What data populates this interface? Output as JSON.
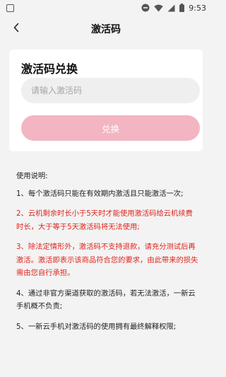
{
  "status_bar": {
    "time": "9:53"
  },
  "header": {
    "title": "激活码"
  },
  "redeem_card": {
    "title": "激活码兑换",
    "input_placeholder": "请输入激活码",
    "input_value": "",
    "button_label": "兑换"
  },
  "instructions": {
    "heading": "使用说明:",
    "items": [
      {
        "text": "1、每个激活码只能在有效期内激活且只能激活一次;",
        "color": "#222222"
      },
      {
        "text": "2、云机剩余时长小于5天时才能使用激活码给云机续费时长，大于等于5天激活码将无法使用;",
        "color": "#e0241d"
      },
      {
        "text": "3、除法定情形外，激活码不支持退款，请充分测试后再激活。激活即表示该商品符合您的要求，由此带来的损失需由您自行承担。",
        "color": "#e0241d"
      },
      {
        "text": "4、通过非官方渠道获取的激活码，若无法激活，一新云手机概不负责;",
        "color": "#222222"
      },
      {
        "text": "5、一新云手机对激活码的使用拥有最终解释权限;",
        "color": "#222222"
      }
    ]
  },
  "colors": {
    "background": "#f3f3f3",
    "card": "#ffffff",
    "button": "#f2b5c1",
    "warning_text": "#e0241d"
  }
}
